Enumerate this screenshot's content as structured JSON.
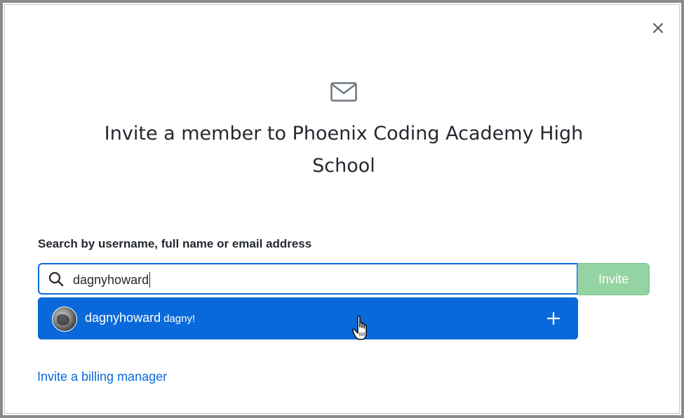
{
  "dialog": {
    "close_icon": "close-icon",
    "header_icon": "mail-icon",
    "title": "Invite a member to Phoenix Coding Academy High School"
  },
  "search": {
    "label": "Search by username, full name or email address",
    "icon": "search-icon",
    "value": "dagnyhoward",
    "invite_label": "Invite"
  },
  "suggestion": {
    "username": "dagnyhoward",
    "full_name": "dagny!",
    "add_icon": "plus-icon",
    "accent": "#0969da"
  },
  "footer": {
    "billing_link": "Invite a billing manager"
  },
  "colors": {
    "invite_button_disabled": "#94d3a2",
    "link": "#0969da",
    "focus_border": "#0969da"
  }
}
